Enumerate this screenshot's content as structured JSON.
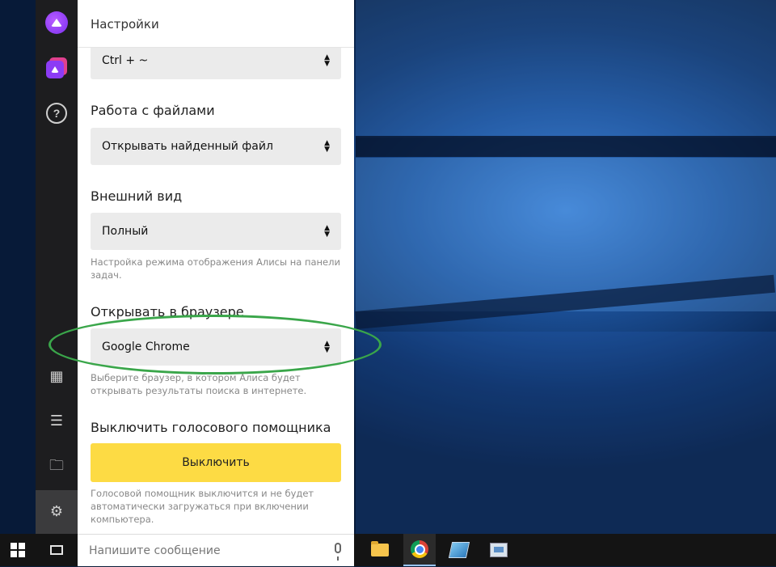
{
  "panel": {
    "title": "Настройки",
    "hotkey_select": {
      "value": "Ctrl + ~"
    },
    "files": {
      "title": "Работа с файлами",
      "select_value": "Открывать найденный файл"
    },
    "appearance": {
      "title": "Внешний вид",
      "select_value": "Полный",
      "hint": "Настройка режима отображения Алисы на панели задач."
    },
    "browser": {
      "title": "Открывать в браузере",
      "select_value": "Google Chrome",
      "hint": "Выберите браузер, в котором Алиса будет открывать результаты поиска в интернете."
    },
    "voice": {
      "title": "Выключить голосового помощника",
      "button_label": "Выключить",
      "hint": "Голосовой помощник выключится и не будет автоматически загружаться при включении компьютера."
    }
  },
  "sidebar": {
    "icons": [
      "alice-logo",
      "alice-skills-logo",
      "help-icon",
      "dashboard-icon",
      "menu-list-icon",
      "folder-icon",
      "settings-gear-icon"
    ],
    "help_glyph": "?",
    "dashboard_glyph": "▦",
    "list_glyph": "☰",
    "folder_glyph": "🗀",
    "gear_glyph": "⚙"
  },
  "taskbar": {
    "message_placeholder": "Напишите сообщение",
    "apps": [
      "file-explorer-icon",
      "chrome-icon",
      "app-icon-3",
      "app-icon-4"
    ]
  },
  "colors": {
    "accent_yellow": "#fddb44",
    "highlight_green": "#3aa64a",
    "alice_purple": "#8c3cf5"
  }
}
